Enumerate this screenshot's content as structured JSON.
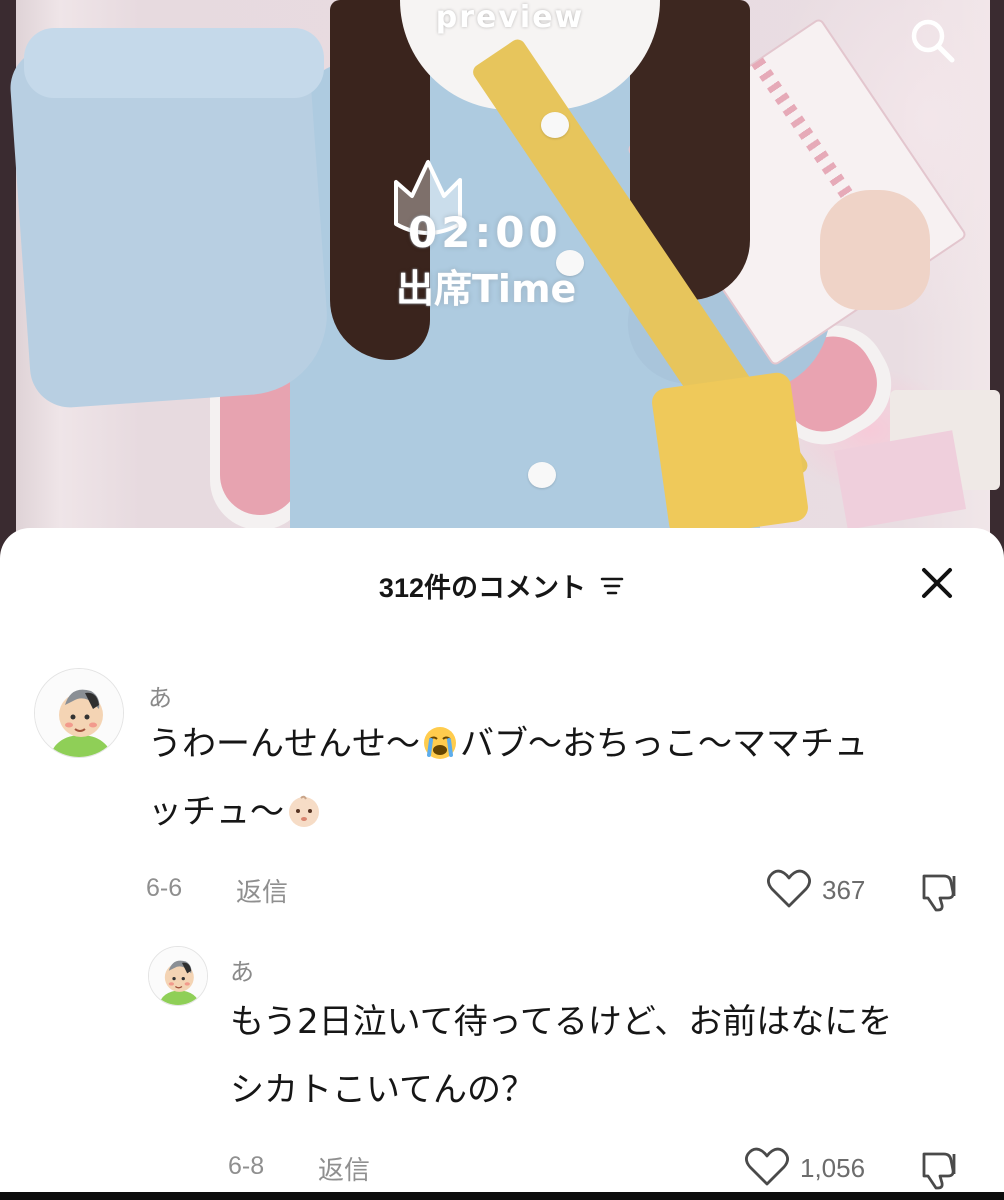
{
  "video": {
    "label": "preview",
    "timer": "02:00",
    "timer_caption": "出席Time"
  },
  "icons": {
    "search": "search-icon",
    "close": "close-icon",
    "sort": "sort-icon",
    "like": "heart-icon",
    "dislike": "thumbs-down-icon"
  },
  "comments_panel": {
    "title": "312件のコメント",
    "comments": [
      {
        "username": "あ",
        "text_line1_a": "うわーんせんせ〜",
        "text_line1_b": "バブ〜おちっこ〜ママチュ",
        "text_line2": "ッチュ〜",
        "date": "6-6",
        "reply_label": "返信",
        "likes": "367"
      },
      {
        "username": "あ",
        "text_line1": "もう2日泣いて待ってるけど、お前はなにを",
        "text_line2": "シカトこいてんの？",
        "date": "6-8",
        "reply_label": "返信",
        "likes": "1,056"
      }
    ]
  },
  "colors": {
    "sheet_background": "#ffffff",
    "primary_text": "#161616",
    "secondary_text": "#8f8f8f"
  }
}
